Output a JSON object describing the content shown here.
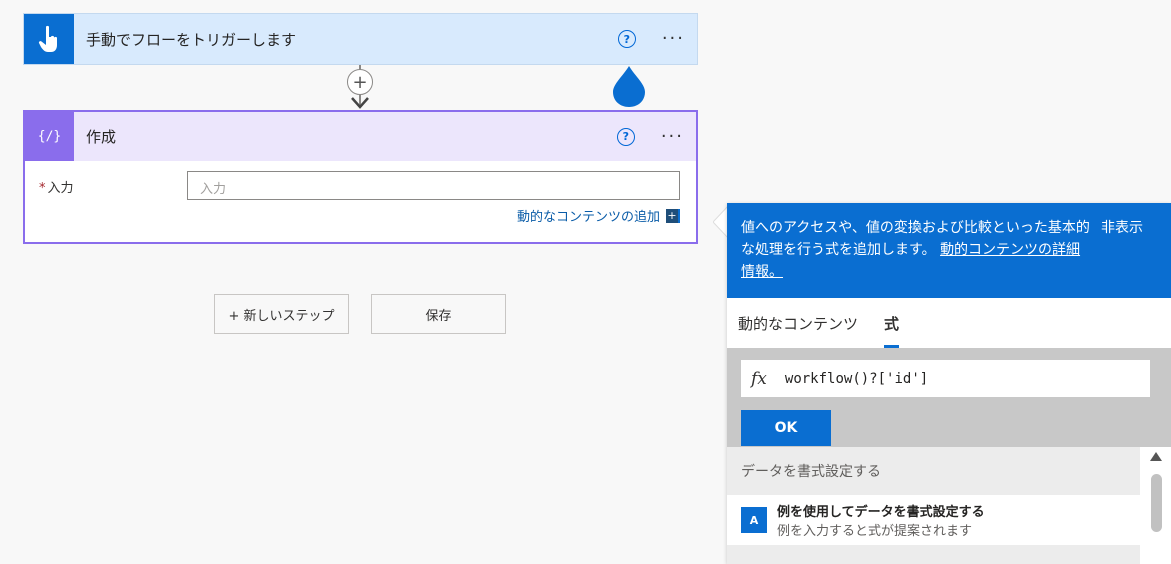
{
  "trigger": {
    "title": "手動でフローをトリガーします",
    "help": "?",
    "more": "···"
  },
  "connector": {
    "plus": "+"
  },
  "compose": {
    "title": "作成",
    "icon": "{∕}",
    "help": "?",
    "more": "···",
    "field_required": "*",
    "field_label": "入力",
    "field_placeholder": "入力",
    "dynamic_link": "動的なコンテンツの追加",
    "dynamic_plus": "+"
  },
  "buttons": {
    "new_step": "+ 新しいステップ",
    "save": "保存"
  },
  "panel": {
    "intro": "値へのアクセスや、値の変換および比較といった基本的な処理を行う式を追加します。",
    "learn_more": "動的コンテンツの詳細情報。",
    "hide": "非表示",
    "tabs": [
      {
        "label": "動的なコンテンツ"
      },
      {
        "label": "式"
      }
    ],
    "fx_symbol": "fx",
    "expression": "workflow()?['id']",
    "ok": "OK",
    "section_title": "データを書式設定する",
    "items": [
      {
        "icon": "A",
        "title": "例を使用してデータを書式設定する",
        "description": "例を入力すると式が提案されます"
      }
    ]
  },
  "colors": {
    "accent_blue": "#0a6ed1",
    "compose_purple": "#8a6dec",
    "trigger_bg": "#d8eafd"
  }
}
